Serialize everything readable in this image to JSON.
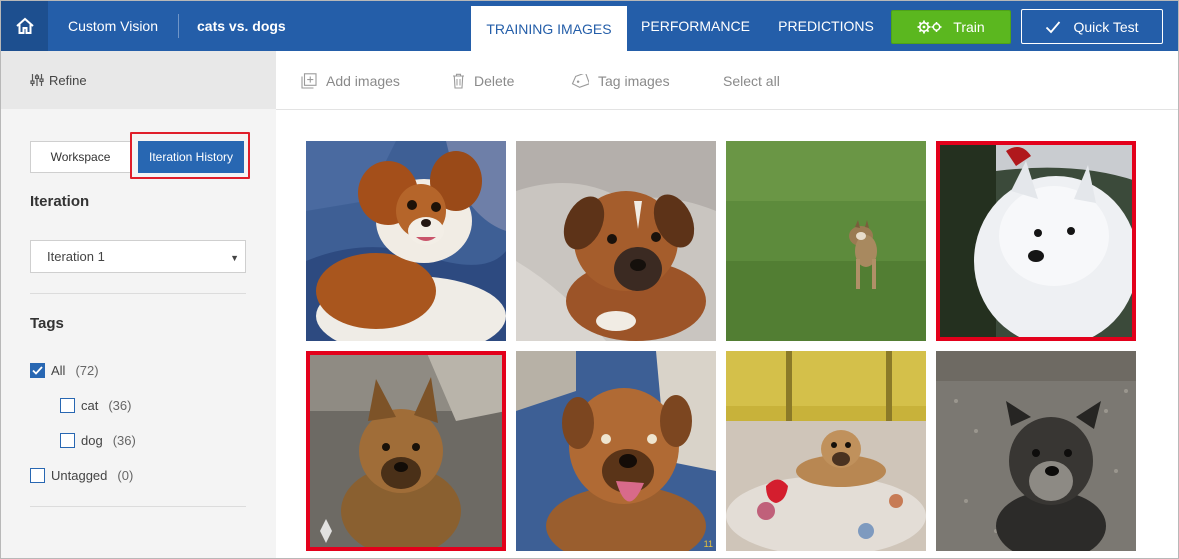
{
  "header": {
    "brand": "Custom Vision",
    "project": "cats vs. dogs",
    "tabs": [
      {
        "label": "TRAINING IMAGES",
        "active": true
      },
      {
        "label": "PERFORMANCE",
        "active": false
      },
      {
        "label": "PREDICTIONS",
        "active": false
      }
    ],
    "train_label": "Train",
    "quick_test_label": "Quick Test",
    "icons": {
      "home": "home-icon",
      "train": "gears-icon",
      "quick_test": "checkmark-icon"
    }
  },
  "sidebar": {
    "refine_label": "Refine",
    "view_toggle": {
      "workspace": "Workspace",
      "history": "Iteration History",
      "selected": "Iteration History"
    },
    "iteration_heading": "Iteration",
    "iteration_selected": "Iteration 1",
    "tags_heading": "Tags",
    "tags": [
      {
        "name": "All",
        "count": "(72)",
        "checked": true
      },
      {
        "name": "cat",
        "count": "(36)",
        "checked": false
      },
      {
        "name": "dog",
        "count": "(36)",
        "checked": false
      },
      {
        "name": "Untagged",
        "count": "(0)",
        "checked": false
      }
    ]
  },
  "toolbar": {
    "add_images": "Add images",
    "delete": "Delete",
    "tag_images": "Tag images",
    "select_all": "Select all"
  },
  "images": [
    {
      "subject": "dog",
      "flagged": false
    },
    {
      "subject": "dog",
      "flagged": false
    },
    {
      "subject": "dog",
      "flagged": false
    },
    {
      "subject": "dog",
      "flagged": true
    },
    {
      "subject": "dog",
      "flagged": true
    },
    {
      "subject": "dog",
      "flagged": false
    },
    {
      "subject": "dog",
      "flagged": false
    },
    {
      "subject": "dog",
      "flagged": false
    }
  ],
  "image_overlay_text": "11",
  "colors": {
    "header_blue": "#245ea9",
    "accent_blue": "#2867b2",
    "train_green": "#5bb71f",
    "flag_red": "#e3001b"
  }
}
